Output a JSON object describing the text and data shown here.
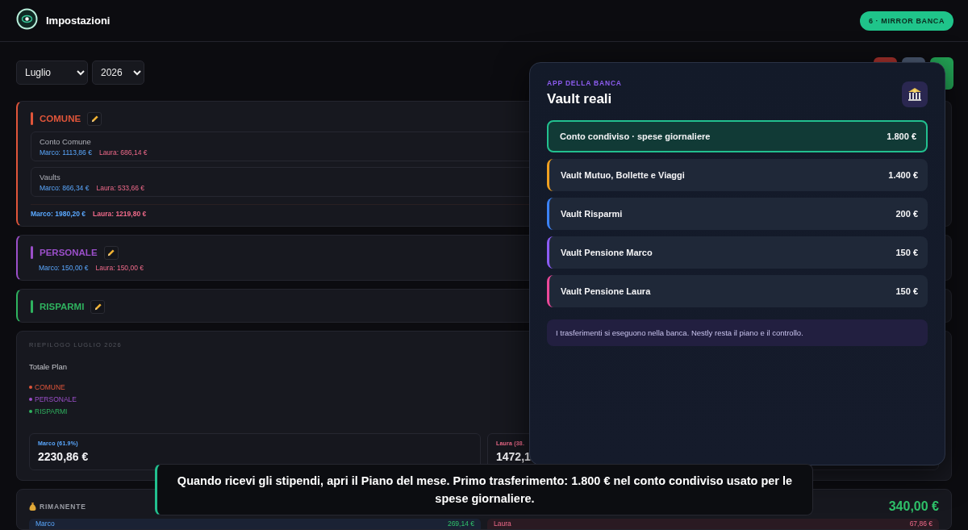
{
  "header": {
    "title": "Impostazioni",
    "step_button": "6 · MIRROR BANCA"
  },
  "filters": {
    "month": "Luglio",
    "year": "2026"
  },
  "categories": [
    {
      "name": "COMUNE",
      "color": "#e0553a",
      "accounts": [
        {
          "name": "Conto Comune",
          "marco": "Marco: 1113,86 €",
          "laura": "Laura: 686,14 €"
        },
        {
          "name": "Vaults",
          "marco": "Marco: 866,34 €",
          "laura": "Laura: 533,66 €"
        }
      ],
      "totals": {
        "marco": "Marco: 1980,20 €",
        "laura": "Laura: 1219,80 €"
      }
    },
    {
      "name": "PERSONALE",
      "color": "#9b4fc9",
      "totals": {
        "marco": "Marco: 150,00 €",
        "laura": "Laura: 150,00 €"
      }
    },
    {
      "name": "RISPARMI",
      "color": "#2fb35f"
    }
  ],
  "summary": {
    "title": "RIEPILOGO LUGLIO 2026",
    "total_label": "Totale Plan",
    "legend": [
      {
        "label": "COMUNE",
        "color": "#e0553a"
      },
      {
        "label": "PERSONALE",
        "color": "#9b4fc9"
      },
      {
        "label": "RISPARMI",
        "color": "#2fb35f"
      }
    ],
    "people": [
      {
        "label": "Marco (61.9%)",
        "amount": "2230,86 €"
      },
      {
        "label": "Laura (38.",
        "amount": "1472,1"
      }
    ]
  },
  "remaining": {
    "label": "RIMANENTE",
    "amount": "340,00 €",
    "people": [
      {
        "name": "Marco",
        "amount": "269,14 €"
      },
      {
        "name": "Laura",
        "amount": "67,86 €"
      }
    ]
  },
  "bank_panel": {
    "eyebrow": "APP DELLA BANCA",
    "title": "Vault reali",
    "vaults": [
      {
        "name": "Conto condiviso · spese giornaliere",
        "amount": "1.800 €",
        "color": "#22c08f",
        "selected": true
      },
      {
        "name": "Vault Mutuo, Bollette e Viaggi",
        "amount": "1.400 €",
        "color": "#f0a020",
        "selected": false
      },
      {
        "name": "Vault Risparmi",
        "amount": "200 €",
        "color": "#3b82f6",
        "selected": false
      },
      {
        "name": "Vault Pensione Marco",
        "amount": "150 €",
        "color": "#8b5cf6",
        "selected": false
      },
      {
        "name": "Vault Pensione Laura",
        "amount": "150 €",
        "color": "#ec4899",
        "selected": false
      }
    ],
    "note": "I trasferimenti si eseguono nella banca. Nestly resta il piano e il controllo."
  },
  "caption": "Quando ricevi gli stipendi, apri il Piano del mese. Primo trasferimento: 1.800 € nel conto condiviso usato per le spese giornaliere."
}
